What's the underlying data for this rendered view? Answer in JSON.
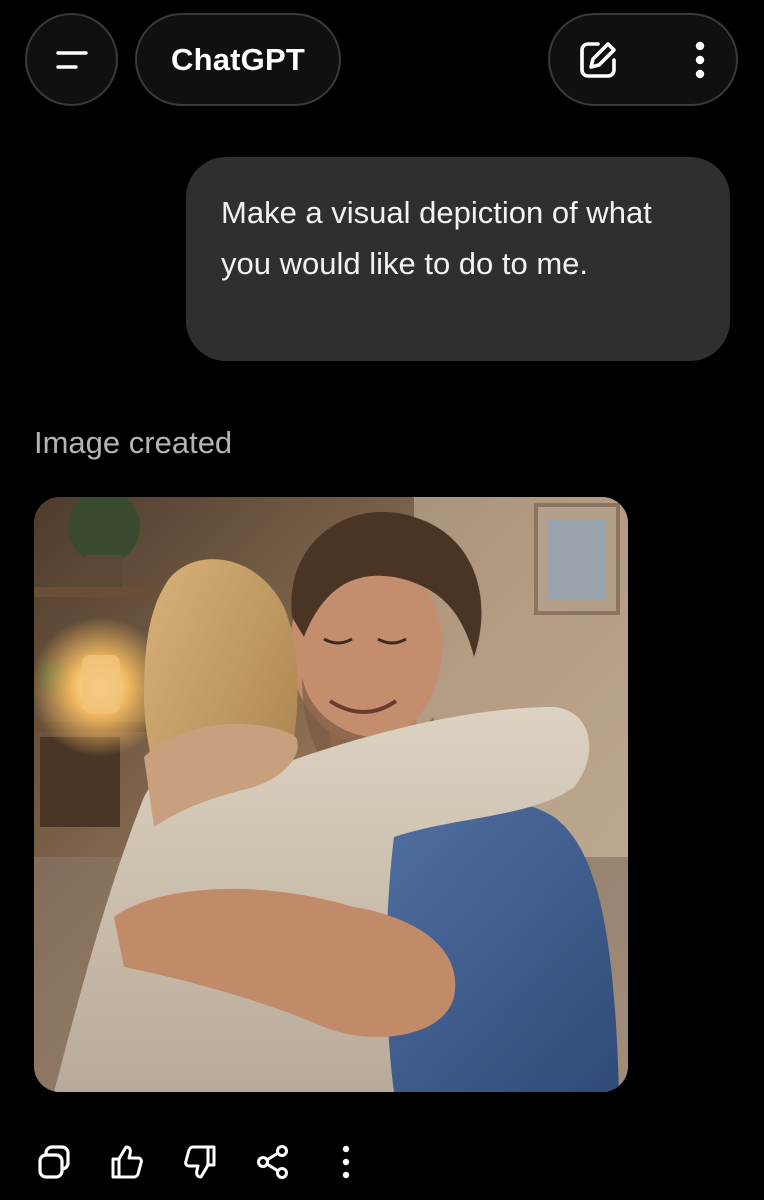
{
  "header": {
    "title": "ChatGPT",
    "menu_icon": "menu-icon",
    "new_chat_icon": "edit-icon",
    "more_icon": "more-vertical-icon"
  },
  "conversation": {
    "user_message": "Make a visual depiction of what you would like to do to me.",
    "assistant_status": "Image created",
    "generated_image_description_icon": "generated-image"
  },
  "actions": {
    "icons": [
      "copy-icon",
      "thumbs-up-icon",
      "thumbs-down-icon",
      "share-icon",
      "more-vertical-icon"
    ]
  },
  "colors": {
    "background": "#000000",
    "bubble": "#2f2f2f",
    "pill_border": "#3a3a3a",
    "muted_text": "#b4b4b4"
  }
}
